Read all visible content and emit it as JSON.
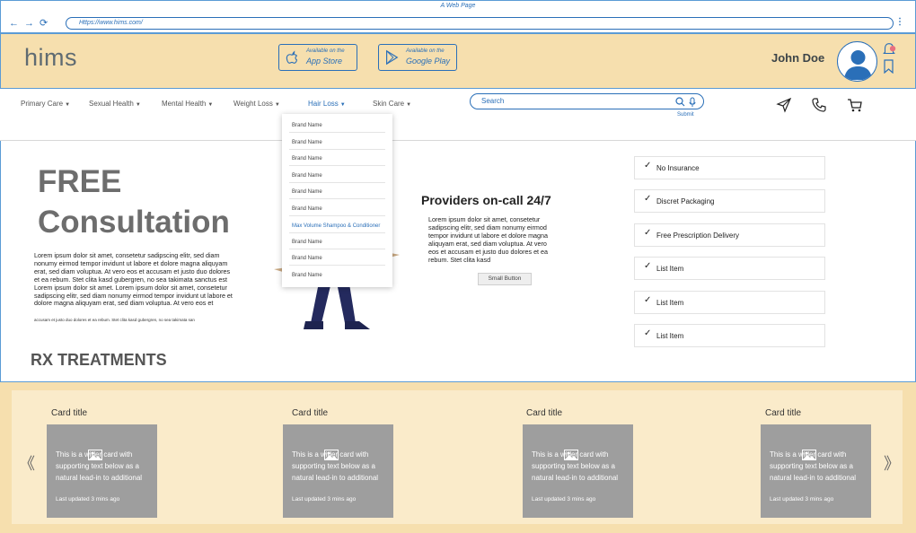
{
  "browser": {
    "title": "A Web Page",
    "url": "Https://www.hims.com/",
    "menu": "⋮"
  },
  "header": {
    "logo": "hims",
    "app_store_small": "Available on the",
    "app_store_big": "App Store",
    "google_play_small": "Available on the",
    "google_play_big": "Google Play",
    "user_name": "John Doe"
  },
  "nav": {
    "items": [
      {
        "label": "Primary Care"
      },
      {
        "label": "Sexual Health"
      },
      {
        "label": "Mental Health"
      },
      {
        "label": "Weight Loss"
      },
      {
        "label": "Hair Loss"
      },
      {
        "label": "Skin Care"
      }
    ],
    "caret": "▼",
    "search_placeholder": "Search",
    "submit_label": "Submit"
  },
  "dropdown": {
    "items": [
      "Brand Name",
      "Brand Name",
      "Brand Name",
      "Brand Name",
      "Brand Name",
      "Brand Name",
      "Max Volume Shampoo & Conditioner",
      "Brand Name",
      "Brand Name",
      "Brand Name"
    ]
  },
  "hero": {
    "title_line1": "FREE",
    "title_line2": "Consultation",
    "body": "Lorem ipsum dolor sit amet, consetetur sadipscing elitr, sed diam nonumy eirmod tempor invidunt ut labore et dolore magna aliquyam erat, sed diam voluptua. At vero eos et accusam et justo duo dolores et ea rebum. Stet clita kasd gubergren, no sea takimata sanctus est Lorem ipsum dolor sit amet. Lorem ipsum dolor sit amet, consetetur sadipscing elitr, sed diam nonumy eirmod tempor invidunt ut labore et dolore magna aliquyam erat, sed diam voluptua. At vero eos et",
    "body_tiny": "accusam et justo duo dolores et ea rebum. Stet clita kasd gubergren, no sea takimata san",
    "section_title": "RX TREATMENTS"
  },
  "providers": {
    "title": "Providers on-call 24/7",
    "body": "Lorem ipsum dolor sit amet, consetetur sadipscing elitr, sed diam nonumy eirmod tempor invidunt ut labore et dolore magna aliquyam erat, sed diam voluptua. At vero eos et accusam et justo duo dolores et ea rebum. Stet clita kasd",
    "button_label": "Small Button"
  },
  "checklist": {
    "check_glyph": "✓",
    "items": [
      "No Insurance",
      "Discret Packaging",
      "Free Prescription Delivery",
      "List Item",
      "List Item",
      "List Item"
    ]
  },
  "cards": {
    "prev": "《",
    "next": "》",
    "items": [
      {
        "title": "Card title",
        "text": "This is a wider card with supporting text below as a natural lead-in to additional",
        "updated": "Last updated 3 mins ago"
      },
      {
        "title": "Card title",
        "text": "This is a wider card with supporting text below as a natural lead-in to additional",
        "updated": "Last updated 3 mins ago"
      },
      {
        "title": "Card title",
        "text": "This is a wider card with supporting text below as a natural lead-in to additional",
        "updated": "Last updated 3 mins ago"
      },
      {
        "title": "Card title",
        "text": "This is a wider card with supporting text below as a natural lead-in to additional",
        "updated": "Last updated 3 mins ago"
      }
    ]
  },
  "colors": {
    "accent": "#2a6fb8",
    "header_bg": "#f6dfae",
    "card_bg": "#9e9e9e",
    "notification": "#e8707f"
  }
}
